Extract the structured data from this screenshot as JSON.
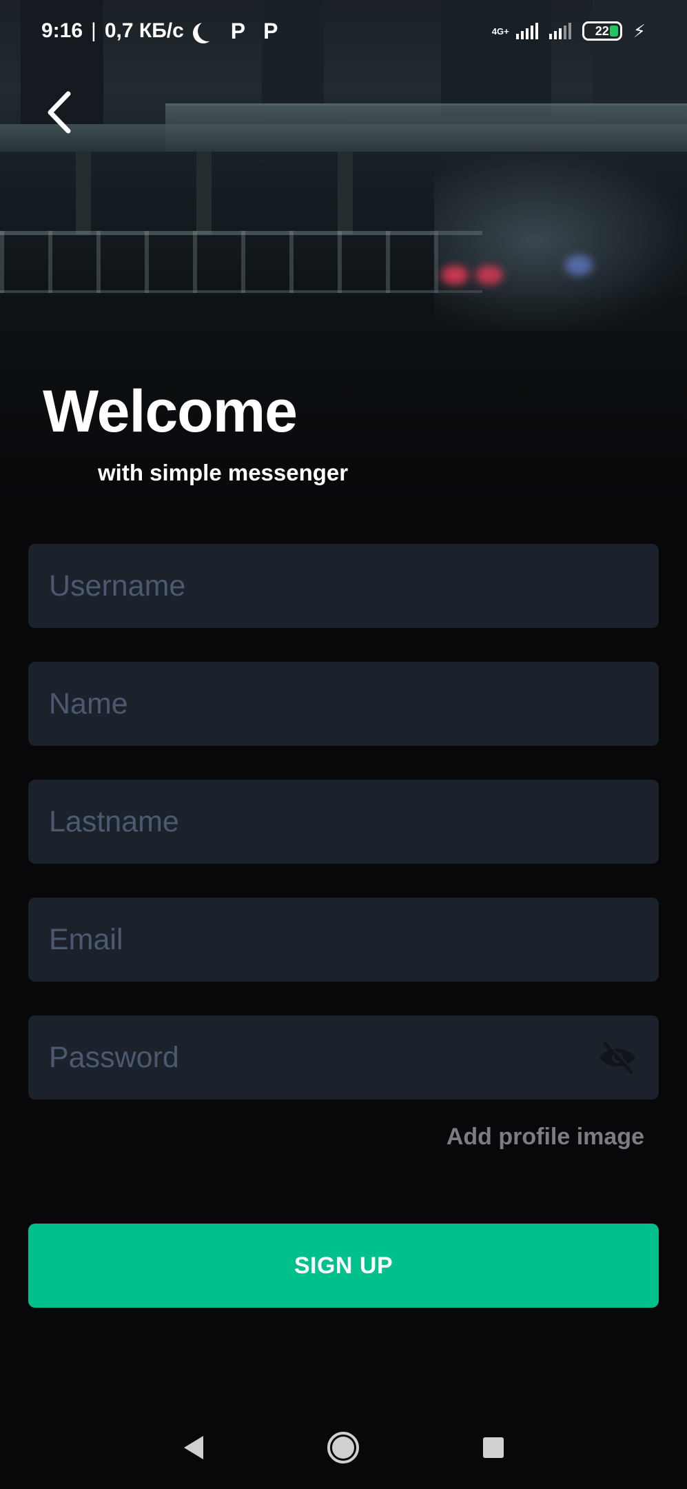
{
  "status_bar": {
    "time": "9:16",
    "separator": "|",
    "network_speed": "0,7 КБ/с",
    "app_icon_1": "P",
    "app_icon_2": "P",
    "network_type": "4G+",
    "battery_level": "22",
    "battery_color": "#22c55e"
  },
  "header": {
    "title": "Welcome",
    "subtitle": "with simple messenger"
  },
  "form": {
    "username": {
      "placeholder": "Username",
      "value": ""
    },
    "name": {
      "placeholder": "Name",
      "value": ""
    },
    "lastname": {
      "placeholder": "Lastname",
      "value": ""
    },
    "email": {
      "placeholder": "Email",
      "value": ""
    },
    "password": {
      "placeholder": "Password",
      "value": ""
    },
    "add_profile_image": "Add profile image",
    "signup_label": "SIGN UP"
  },
  "colors": {
    "accent": "#00c08b",
    "field_bg": "#1c222b",
    "placeholder": "#4b5a6f",
    "background": "#08080b"
  },
  "icons": {
    "back": "chevron-left-icon",
    "password_visibility": "eye-off-icon",
    "nav_back": "triangle-back-icon",
    "nav_home": "circle-home-icon",
    "nav_recents": "square-recents-icon"
  }
}
